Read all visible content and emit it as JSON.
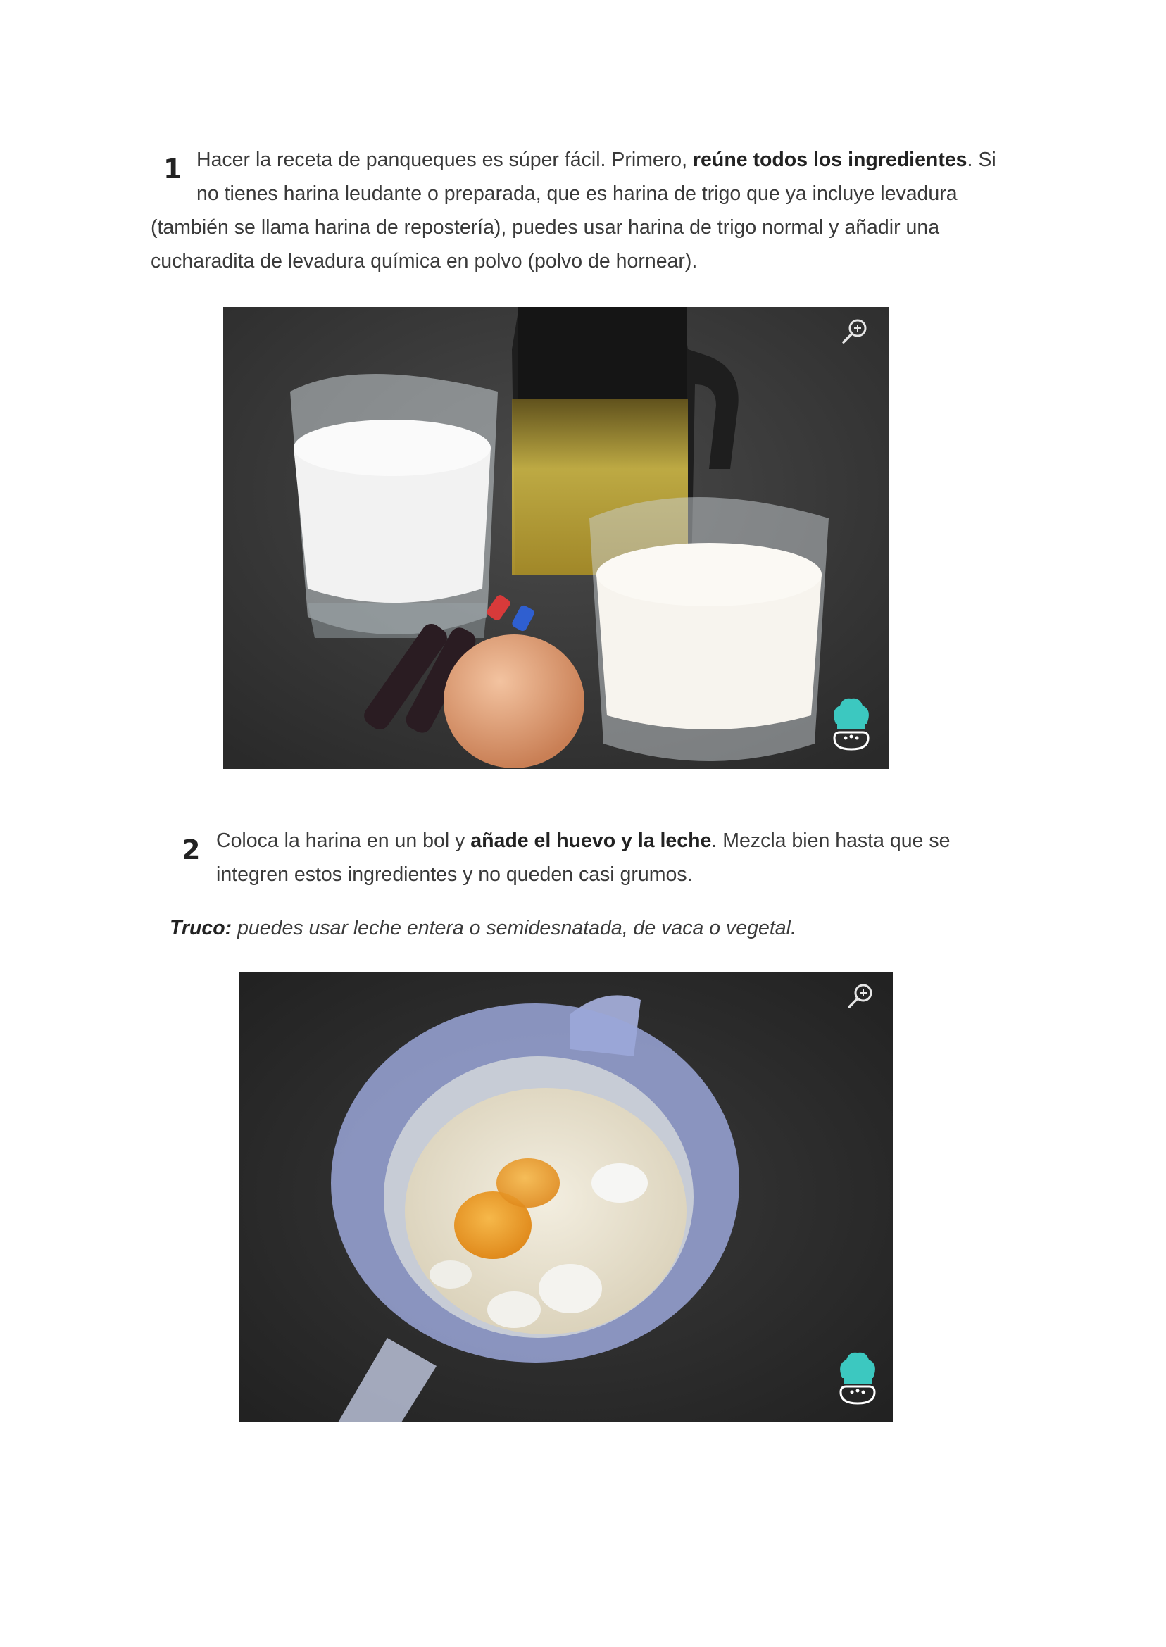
{
  "step1": {
    "number": "1",
    "line1_pre": "Hacer la receta de panqueques es súper fácil. Primero, ",
    "line1_bold": "reúne todos los ingredientes",
    "line1_post": ". Si",
    "line2": "no tienes harina leudante o preparada, que es harina de trigo que ya incluye levadura",
    "line3": "(también se llama harina de repostería), puedes usar harina de trigo normal y añadir una",
    "line4": "cucharadita de levadura química en polvo (polvo de hornear)."
  },
  "step2": {
    "number": "2",
    "line1_pre": "Coloca la harina en un bol y ",
    "line1_bold": "añade el huevo y la leche",
    "line1_post": ". Mezcla bien hasta que se",
    "line2": "integren estos ingredientes y no queden casi grumos."
  },
  "tip": {
    "label": "Truco:",
    "text": " puedes usar leche entera o semidesnatada, de vaca o vegetal."
  },
  "icons": {
    "zoom": "zoom-in-icon",
    "logo": "chef-hat-logo-icon"
  },
  "colors": {
    "brand_teal": "#3cc8c0",
    "text": "#3a3a3a"
  }
}
